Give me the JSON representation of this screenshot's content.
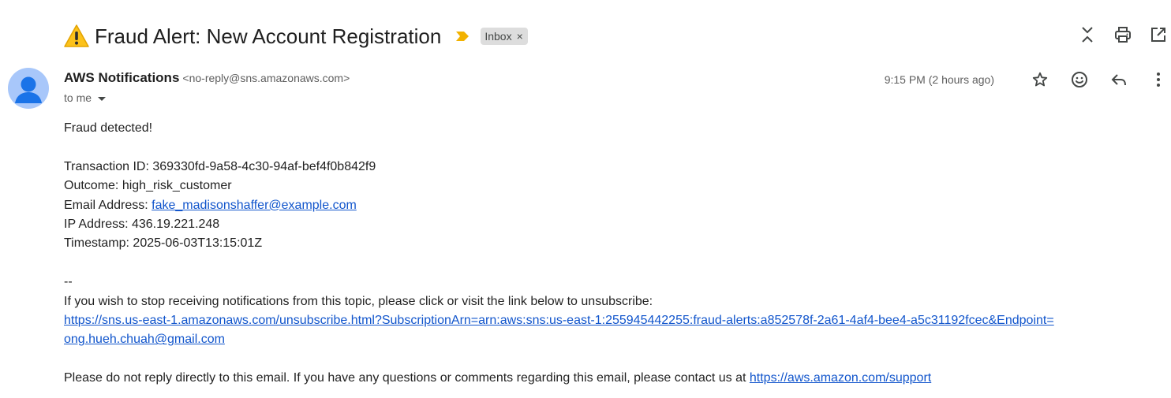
{
  "subject": {
    "warning_icon": "warning-sign-emoji",
    "title": "Fraud Alert: New Account Registration",
    "importance_icon": "importance-marker-icon",
    "label_chip": "Inbox",
    "label_chip_close": "×"
  },
  "top_actions": {
    "collapse_icon": "collapse-all-icon",
    "print_icon": "print-icon",
    "new_window_icon": "open-in-new-window-icon"
  },
  "sender": {
    "name": "AWS Notifications",
    "email": "<no-reply@sns.amazonaws.com>",
    "to_label": "to me",
    "time": "9:15 PM (2 hours ago)"
  },
  "message_actions": {
    "star_icon": "star-icon",
    "emoji_icon": "add-reaction-icon",
    "reply_icon": "reply-icon",
    "more_icon": "more-vert-icon"
  },
  "body": {
    "line1": "Fraud detected!",
    "transaction_label": "Transaction ID: ",
    "transaction_value": "369330fd-9a58-4c30-94af-bef4f0b842f9",
    "outcome_label": "Outcome: ",
    "outcome_value": "high_risk_customer",
    "email_label": "Email Address: ",
    "email_link": "fake_madisonshaffer@example.com",
    "ip_label": "IP Address: ",
    "ip_value": "436.19.221.248",
    "timestamp_label": "Timestamp: ",
    "timestamp_value": "2025-06-03T13:15:01Z",
    "separator": "--",
    "unsubscribe_text": "If you wish to stop receiving notifications from this topic, please click or visit the link below to unsubscribe:",
    "unsubscribe_link_1": "https://sns.us-east-1.amazonaws.com/unsubscribe.html?SubscriptionArn=arn:aws:sns:us-east-1:255945442255:fraud-alerts:a852578f-2a61-4af4-bee4-a5c31192fcec&Endpoint=",
    "unsubscribe_link_2": "ong.hueh.chuah@gmail.com",
    "footer_text": "Please do not reply directly to this email. If you have any questions or comments regarding this email, please contact us at ",
    "footer_link": "https://aws.amazon.com/support"
  },
  "colors": {
    "link": "#1155cc",
    "avatar_bg": "#a8c7fa",
    "avatar_fg": "#1a73e8",
    "chip_bg": "#dddddd",
    "importance": "#f2b200"
  }
}
